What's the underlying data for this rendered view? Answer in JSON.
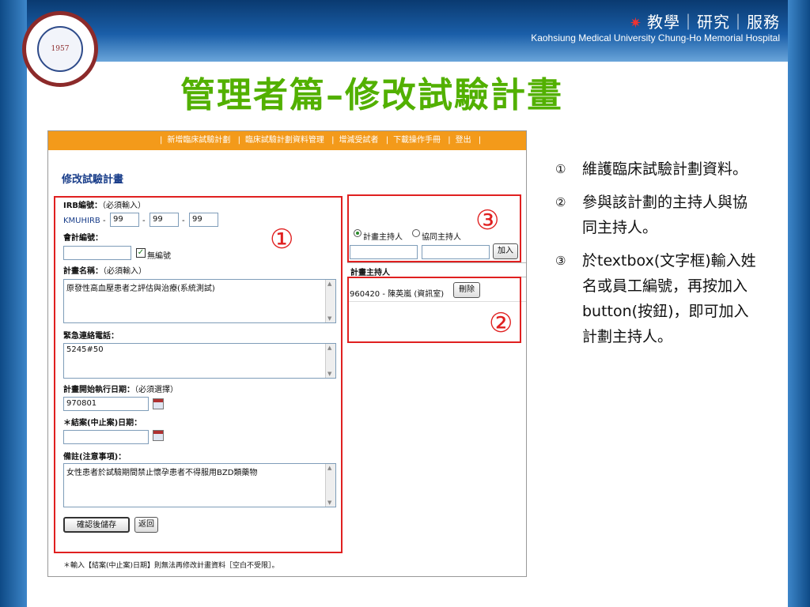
{
  "header": {
    "tagline": "教學｜研究｜服務",
    "hospital": "Kaohsiung Medical University  Chung-Ho Memorial Hospital",
    "slide_title": "管理者篇–修改試驗計畫",
    "logo_text": "1957"
  },
  "nav": {
    "items": [
      "新增臨床試驗計劃",
      "臨床試驗計劃資料管理",
      "增減受試者",
      "下載操作手冊",
      "登出"
    ],
    "sep": "|"
  },
  "form": {
    "title": "修改試驗計畫",
    "irb": {
      "label": "IRB編號：",
      "note": "（必須輸入）",
      "prefix": "KMUHIRB",
      "dash": "-",
      "part1": "99",
      "part2": "99",
      "part3": "99"
    },
    "account": {
      "label": "會計編號：",
      "value": "",
      "checkbox_label": "無編號",
      "checked": true
    },
    "plan_name": {
      "label": "計畫名稱：",
      "note": "（必須輸入）",
      "value": "原發性高血壓患者之評估與治療(系統測試)"
    },
    "emergency": {
      "label": "緊急連絡電話：",
      "value": "5245#50"
    },
    "start_date": {
      "label": "計畫開始執行日期：",
      "note": "（必須選擇）",
      "value": "970801"
    },
    "end_date": {
      "label": "＊結案(中止案)日期：",
      "value": ""
    },
    "remark": {
      "label": "備註(注意事項)：",
      "value": "女性患者於試驗期間禁止懷孕患者不得服用BZD類藥物"
    },
    "save_button": "確認後儲存",
    "back_button": "返回",
    "footnote": "＊輸入【結案(中止案)日期】則無法再修改計畫資料［空白不受限］。"
  },
  "investigator": {
    "radio_pi": "計畫主持人",
    "radio_co": "協同主持人",
    "selected": "pi",
    "input1": "",
    "input2": "",
    "add_button": "加入",
    "list_header": "計畫主持人",
    "entry": "960420 - 陳英嵐 (資訊室)",
    "delete_button": "刪除"
  },
  "callouts": {
    "one": "①",
    "two": "②",
    "three": "③"
  },
  "notes": [
    {
      "num": "①",
      "text": "維護臨床試驗計劃資料。"
    },
    {
      "num": "②",
      "text": "參與該計劃的主持人與協同主持人。"
    },
    {
      "num": "③",
      "text": "於textbox(文字框)輸入姓名或員工編號，再按加入button(按鈕)，即可加入計劃主持人。"
    }
  ],
  "colors": {
    "accent_green": "#52b000",
    "nav_orange": "#f39a1a",
    "callout_red": "#e02020"
  }
}
